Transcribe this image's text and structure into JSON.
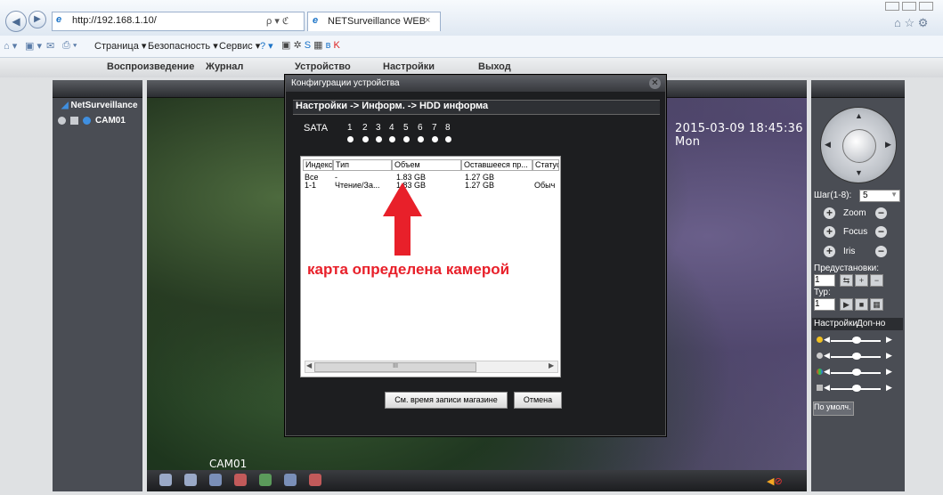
{
  "browser": {
    "url": "http://192.168.1.10/",
    "tab_title": "NETSurveillance WEB",
    "tab_close": "×",
    "search_glyph": "ρ ▾ ℭ",
    "commands": [
      "Страница ▾",
      "Безопасность ▾",
      "Сервис ▾"
    ]
  },
  "app": {
    "menu": [
      "Воспроизведение",
      "Журнал",
      "Устройство",
      "Настройки",
      "Выход"
    ],
    "tree_root": "NetSurveillance",
    "camera": "CAM01",
    "osd_time": "2015-03-09 18:45:36 Mon",
    "osd_cam": "CAM01"
  },
  "ptz": {
    "step_label": "Шаг(1-8):",
    "step_value": "5",
    "zoom": "Zoom",
    "focus": "Focus",
    "iris": "Iris",
    "presets_label": "Предустановки:",
    "preset_value": "1",
    "tour_label": "Тур:",
    "tour_value": "1",
    "tab_settings": "Настройки",
    "tab_extra": "Доп-но",
    "default_button": "По умолч."
  },
  "dialog": {
    "title": "Конфигурации устройства",
    "close": "✕",
    "breadcrumb": "Настройки -> Информ. -> HDD информа",
    "sata_label": "SATA",
    "ports": [
      "1",
      "2",
      "3",
      "4",
      "5",
      "6",
      "7",
      "8"
    ],
    "columns": [
      "Индекс",
      "Тип",
      "Объем",
      "Оставшееся пр...",
      "Статус"
    ],
    "rows": [
      [
        "Все",
        "-",
        "1.83 GB",
        "1.27 GB",
        ""
      ],
      [
        "1-1",
        "Чтение/За...",
        "1.83 GB",
        "1.27 GB",
        "Обыч"
      ]
    ],
    "scroll_marker": "III",
    "btn_record_time": "См. время записи магазине",
    "btn_cancel": "Отмена"
  },
  "annotation": "карта определена камерой",
  "colors": {
    "annotation": "#e8202a",
    "accent": "#3f8fe0"
  }
}
